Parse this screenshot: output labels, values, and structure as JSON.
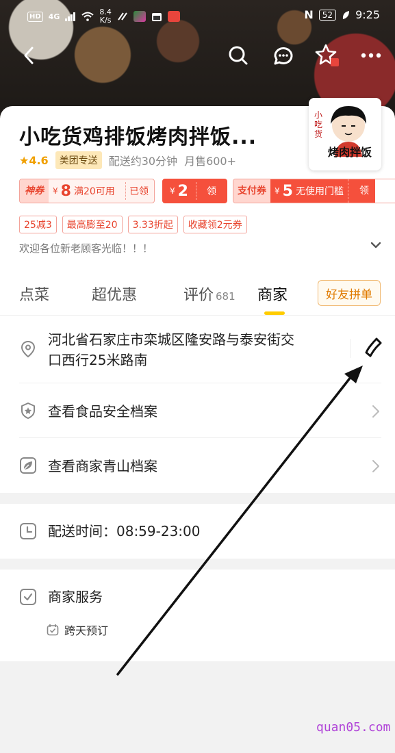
{
  "status_bar": {
    "hd": "HD",
    "network": "4G",
    "speed_value": "8.4",
    "speed_unit": "K/s",
    "battery": "52",
    "time": "9:25"
  },
  "store": {
    "name": "小吃货鸡排饭烤肉拌饭...",
    "rating": "4.6",
    "delivery_tag": "美团专送",
    "delivery_time": "配送约30分钟",
    "monthly_sales": "月售600+",
    "logo_text_top": "小吃货",
    "logo_text_bottom": "烤肉拌饭"
  },
  "coupons": {
    "c1_label": "神券",
    "c1_currency": "¥",
    "c1_amount": "8",
    "c1_desc": "满20可用",
    "c1_action": "已领",
    "c2_currency": "¥",
    "c2_amount": "2",
    "c2_action": "领",
    "c3_label": "支付券",
    "c3_currency": "¥",
    "c3_amount": "5",
    "c3_desc": "无使用门槛",
    "c3_action": "领"
  },
  "promo_tags": [
    "25减3",
    "最高膨至20",
    "3.33折起",
    "收藏领2元券"
  ],
  "notice": "欢迎各位新老顾客光临！！！",
  "tabs": {
    "order": "点菜",
    "deals": "超优惠",
    "reviews": "评价",
    "reviews_count": "681",
    "merchant": "商家",
    "group_button": "好友拼单"
  },
  "merchant_info": {
    "address_line1": "河北省石家庄市栾城区隆安路与泰安街交",
    "address_line2": "口西行25米路南",
    "food_safety": "查看食品安全档案",
    "green_archive": "查看商家青山档案",
    "delivery_hours": "配送时间：08:59-23:00",
    "services_title": "商家服务",
    "service_item": "跨天预订"
  },
  "watermark": "quan05.com",
  "colors": {
    "accent_yellow": "#ffcc00",
    "coupon_red": "#f5503c",
    "rating_orange": "#f0a000",
    "watermark_purple": "#b044d8"
  },
  "icons": [
    "back-icon",
    "search-icon",
    "chat-icon",
    "favorite-star-icon",
    "more-icon",
    "location-pin-icon",
    "phone-icon",
    "shield-icon",
    "leaf-icon",
    "clock-icon",
    "checkbox-icon",
    "calendar-check-icon",
    "chevron-down-icon",
    "chevron-right-icon"
  ]
}
